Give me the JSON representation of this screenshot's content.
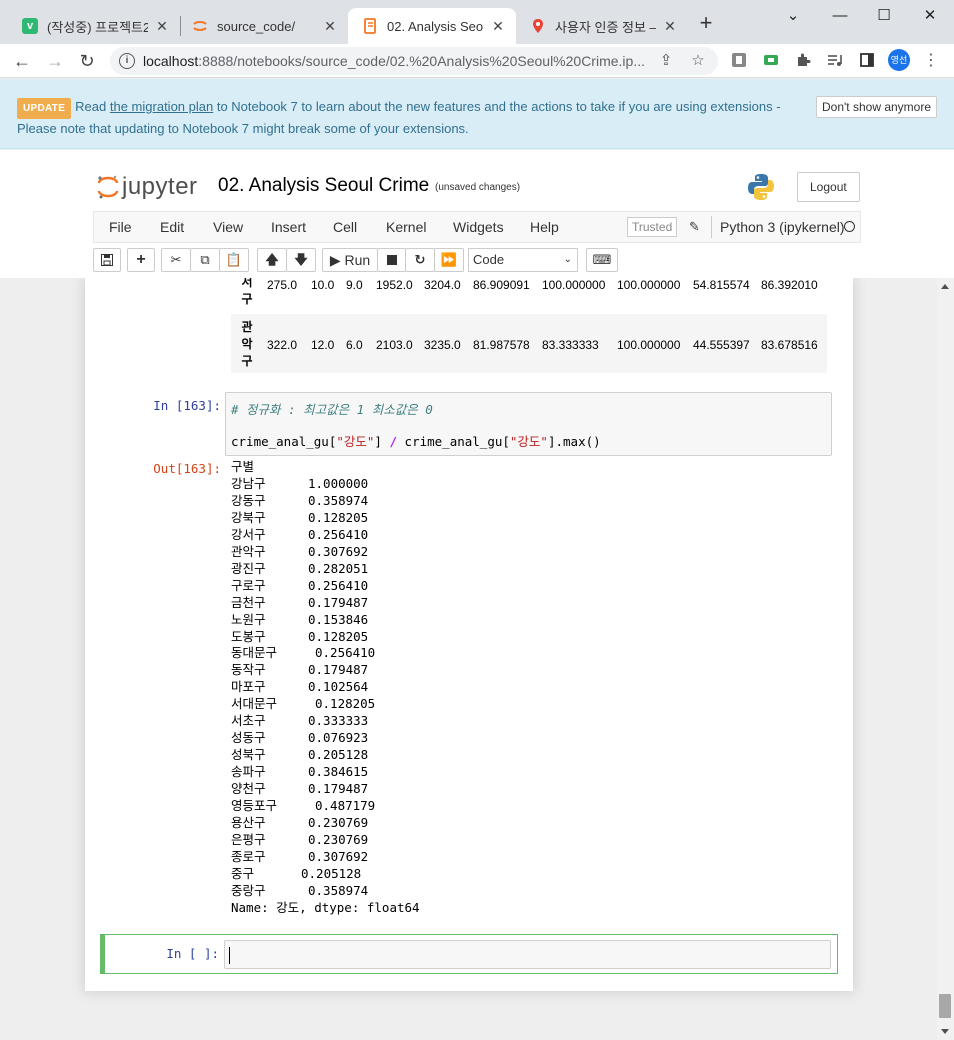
{
  "browser": {
    "tabs": [
      {
        "title": "(작성중) 프로젝트2",
        "close": "✕"
      },
      {
        "title": "source_code/",
        "close": "✕"
      },
      {
        "title": "02. Analysis Seoul",
        "close": "✕"
      },
      {
        "title": "사용자 인증 정보 –",
        "close": "✕"
      }
    ],
    "new_tab": "+",
    "url_host": "localhost",
    "url_path": ":8888/notebooks/source_code/02.%20Analysis%20Seoul%20Crime.ip...",
    "profile_initials": "영선"
  },
  "banner": {
    "badge": "UPDATE",
    "text_before": "Read ",
    "link": "the migration plan",
    "text_after": " to Notebook 7 to learn about the new features and the actions to take if you are using extensions - Please note that updating to Notebook 7 might break some of your extensions.",
    "dismiss": "Don't show anymore"
  },
  "jupyter": {
    "logo_text": "jupyter",
    "notebook_title": "02. Analysis Seoul Crime",
    "save_status": "(unsaved changes)",
    "logout": "Logout",
    "menu": [
      "File",
      "Edit",
      "View",
      "Insert",
      "Cell",
      "Kernel",
      "Widgets",
      "Help"
    ],
    "trusted": "Trusted",
    "kernel": "Python 3 (ipykernel)",
    "run_label": "Run",
    "cell_type": "Code"
  },
  "dataframe_rows": [
    {
      "index": [
        "서",
        "구"
      ],
      "values": [
        "275.0",
        "10.0",
        "9.0",
        "1952.0",
        "3204.0",
        "86.909091",
        "100.000000",
        "100.000000",
        "54.815574",
        "86.392010"
      ]
    },
    {
      "index": [
        "관",
        "악",
        "구"
      ],
      "values": [
        "322.0",
        "12.0",
        "6.0",
        "2103.0",
        "3235.0",
        "81.987578",
        "83.333333",
        "100.000000",
        "44.555397",
        "83.678516"
      ]
    }
  ],
  "cell": {
    "in_prompt": "In [163]:",
    "out_prompt": "Out[163]:",
    "comment": "# 정규화 : 최고값은 1 최소값은 0",
    "code_part1": "crime_anal_gu[",
    "code_str1": "\"강도\"",
    "code_part2": "] ",
    "code_op": "/",
    "code_part3": " crime_anal_gu[",
    "code_str2": "\"강도\"",
    "code_part4": "].max()",
    "output_header": "구별",
    "output_rows": [
      {
        "name": "강남구",
        "value": "1.000000"
      },
      {
        "name": "강동구",
        "value": "0.358974"
      },
      {
        "name": "강북구",
        "value": "0.128205"
      },
      {
        "name": "강서구",
        "value": "0.256410"
      },
      {
        "name": "관악구",
        "value": "0.307692"
      },
      {
        "name": "광진구",
        "value": "0.282051"
      },
      {
        "name": "구로구",
        "value": "0.256410"
      },
      {
        "name": "금천구",
        "value": "0.179487"
      },
      {
        "name": "노원구",
        "value": "0.153846"
      },
      {
        "name": "도봉구",
        "value": "0.128205"
      },
      {
        "name": "동대문구",
        "value": "0.256410"
      },
      {
        "name": "동작구",
        "value": "0.179487"
      },
      {
        "name": "마포구",
        "value": "0.102564"
      },
      {
        "name": "서대문구",
        "value": "0.128205"
      },
      {
        "name": "서초구",
        "value": "0.333333"
      },
      {
        "name": "성동구",
        "value": "0.076923"
      },
      {
        "name": "성북구",
        "value": "0.205128"
      },
      {
        "name": "송파구",
        "value": "0.384615"
      },
      {
        "name": "양천구",
        "value": "0.179487"
      },
      {
        "name": "영등포구",
        "value": "0.487179"
      },
      {
        "name": "용산구",
        "value": "0.230769"
      },
      {
        "name": "은평구",
        "value": "0.230769"
      },
      {
        "name": "종로구",
        "value": "0.307692"
      },
      {
        "name": "중구",
        "value": "0.205128"
      },
      {
        "name": "중랑구",
        "value": "0.358974"
      }
    ],
    "output_footer": "Name: 강도, dtype: float64"
  },
  "empty_cell": {
    "in_prompt": "In [ ]:"
  },
  "colors": {
    "in_prompt": "#303f9f",
    "out_prompt": "#d84315",
    "selected_cell": "#66bb6a",
    "update_badge": "#f0ad4e"
  }
}
